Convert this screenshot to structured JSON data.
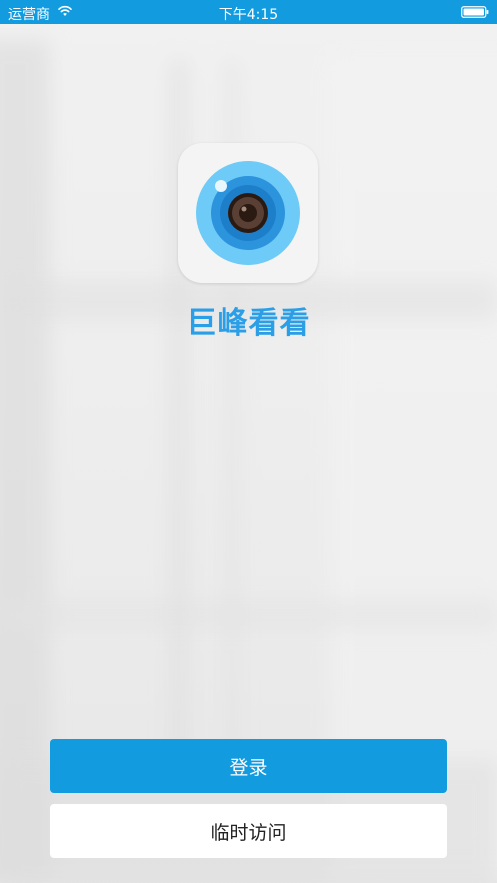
{
  "status_bar": {
    "carrier": "运营商",
    "time": "下午4:15",
    "background_color": "#139be0",
    "wifi_icon": "wifi-icon",
    "battery_icon": "battery-icon"
  },
  "app": {
    "name": "巨峰看看",
    "logo_icon": "camera-lens-icon",
    "brand_color": "#2a9ee6"
  },
  "actions": {
    "login_label": "登录",
    "guest_label": "临时访问",
    "primary_color": "#139be0"
  }
}
